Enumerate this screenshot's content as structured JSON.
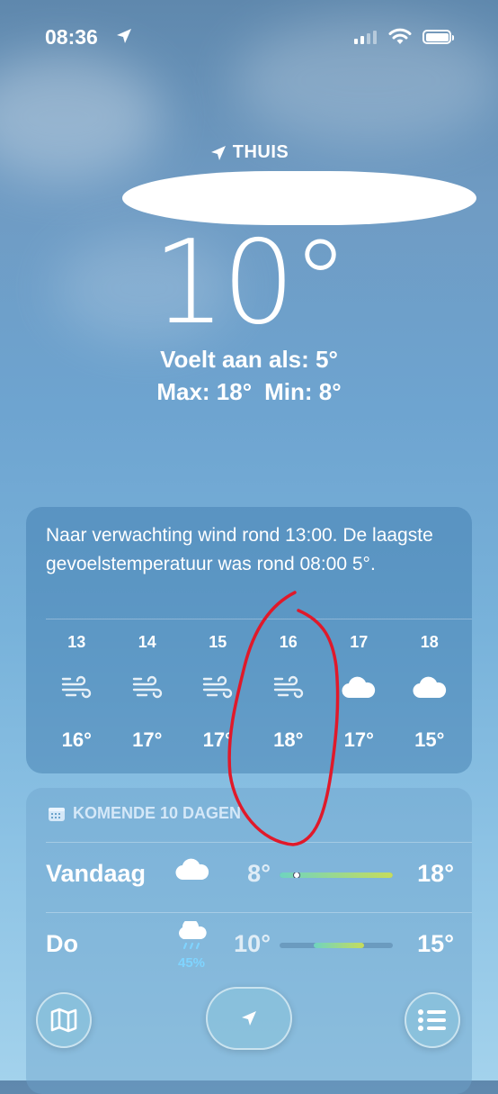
{
  "status_bar": {
    "time": "08:36",
    "location_icon": "location-arrow-icon",
    "signal_icon": "cellular-signal-icon",
    "wifi_icon": "wifi-icon",
    "battery_icon": "battery-icon"
  },
  "location": {
    "label": "THUIS",
    "icon": "location-arrow-icon"
  },
  "current": {
    "temperature": "10°",
    "feels_like": "Voelt aan als: 5°",
    "max": "Max: 18°",
    "min": "Min: 8°"
  },
  "hourly": {
    "summary": "Naar verwachting wind rond 13:00. De laagste gevoelstemperatuur was rond 08:00 5°.",
    "items": [
      {
        "hour": "13",
        "icon": "wind-icon",
        "temp": "16°"
      },
      {
        "hour": "14",
        "icon": "wind-icon",
        "temp": "17°"
      },
      {
        "hour": "15",
        "icon": "wind-icon",
        "temp": "17°"
      },
      {
        "hour": "16",
        "icon": "wind-icon",
        "temp": "18°"
      },
      {
        "hour": "17",
        "icon": "cloud-icon",
        "temp": "17°"
      },
      {
        "hour": "18",
        "icon": "cloud-icon",
        "temp": "15°"
      }
    ]
  },
  "daily": {
    "title": "KOMENDE 10 DAGEN",
    "title_icon": "calendar-icon",
    "days": [
      {
        "name": "Vandaag",
        "icon": "cloud-icon",
        "precip": "",
        "low": "8°",
        "high": "18°",
        "bar_start": 0.0,
        "bar_end": 1.0,
        "current": 0.15
      },
      {
        "name": "Do",
        "icon": "cloud-rain-icon",
        "precip": "45%",
        "low": "10°",
        "high": "15°",
        "bar_start": 0.3,
        "bar_end": 0.75,
        "current": null
      }
    ]
  },
  "bottom_bar": {
    "map_icon": "map-icon",
    "location_icon": "location-arrow-icon",
    "list_icon": "list-icon"
  },
  "colors": {
    "annotation": "#e0192a",
    "precip": "#7fd4ff"
  }
}
